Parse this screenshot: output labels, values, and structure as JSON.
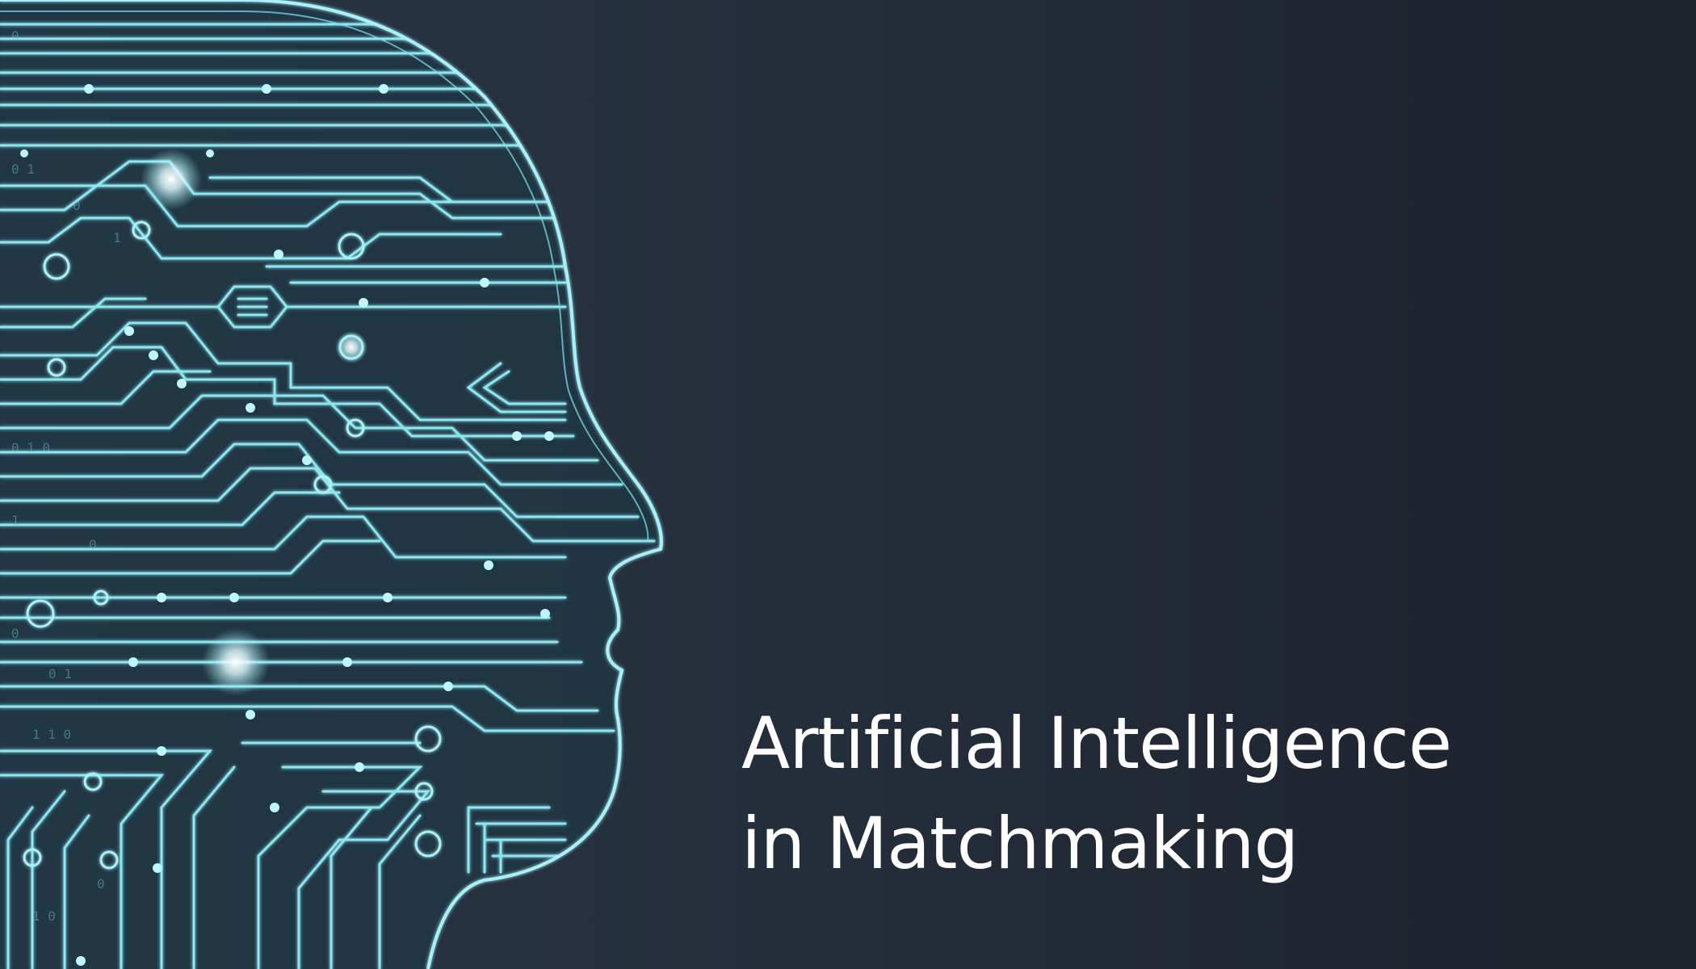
{
  "image": {
    "subject": "ai-circuit-head-icon",
    "colors": {
      "background": "#232b37",
      "circuit_line": "#7fe3ee",
      "circuit_glow": "#bdf6ff",
      "text": "#ffffff"
    }
  },
  "headline": {
    "line1": "Artificial Intelligence",
    "line2": "in Matchmaking"
  }
}
